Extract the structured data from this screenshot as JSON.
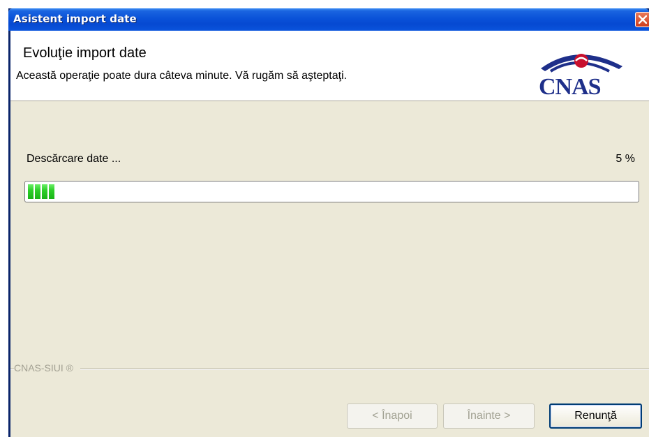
{
  "window": {
    "title": "Asistent import date"
  },
  "header": {
    "title": "Evoluţie import date",
    "subtitle": "Această operaţie poate dura câteva minute. Vă rugăm să aşteptaţi.",
    "logo_text": "CNAS"
  },
  "progress": {
    "label": "Descărcare date ...",
    "percent_text": "5 %",
    "value": 0.05
  },
  "footer": {
    "brand": "CNAS-SIUI ®"
  },
  "buttons": {
    "back": "< Înapoi",
    "next": "Înainte >",
    "cancel": "Renunţă"
  },
  "colors": {
    "titlebar": "#0a52d8",
    "progress_fill": "#2ecf2a",
    "logo": "#1e2f8a",
    "logo_accent": "#c8102e"
  },
  "icons": {
    "close": "close-icon",
    "logo": "cnas-logo"
  }
}
